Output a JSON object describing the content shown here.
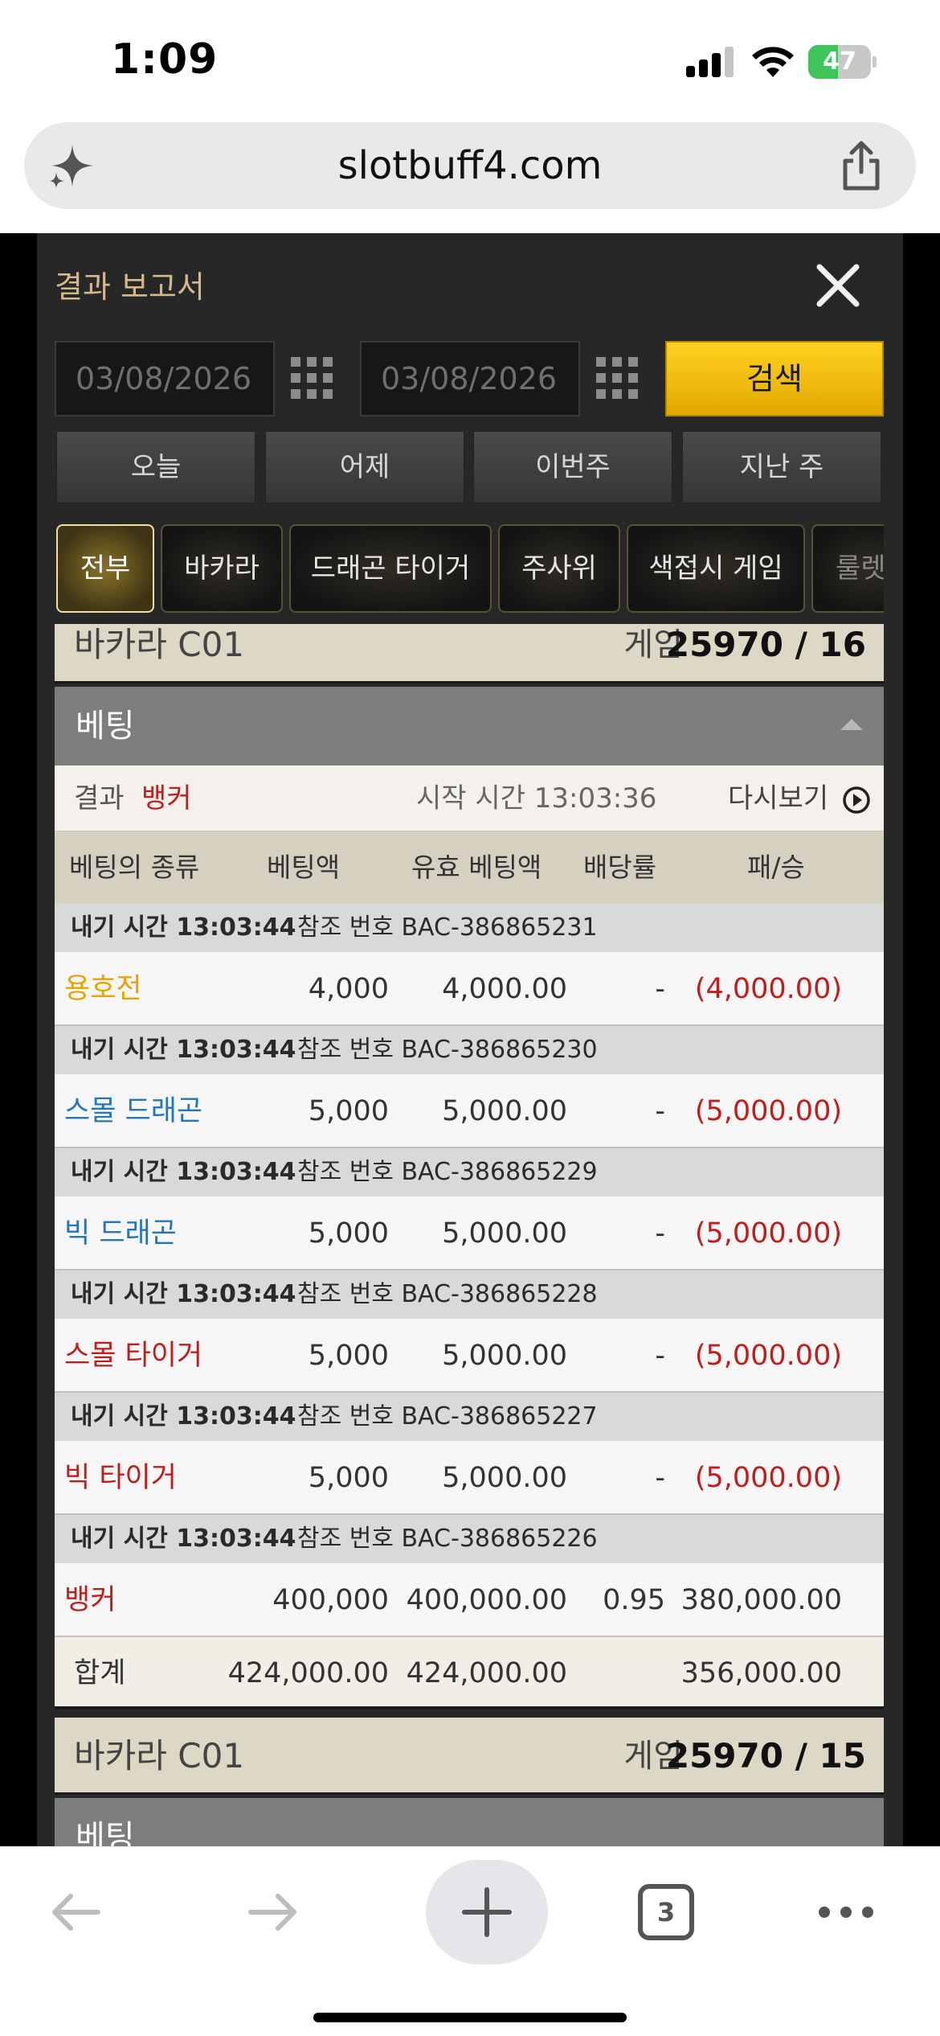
{
  "status_bar": {
    "time": "1:09",
    "battery": "47",
    "battery_level": 0.47
  },
  "browser": {
    "url": "slotbuff4.com",
    "tab_count": "3"
  },
  "report": {
    "title": "결과 보고서",
    "date_from": "03/08/2026",
    "date_to": "03/08/2026",
    "search_label": "검색",
    "periods": [
      "오늘",
      "어제",
      "이번주",
      "지난 주"
    ],
    "filters": [
      "전부",
      "바카라",
      "드래곤 타이거",
      "주사위",
      "색접시 게임",
      "룰렛"
    ]
  },
  "games": [
    {
      "name": "바카라 C01",
      "label": "게임",
      "number": "25970 / 16",
      "betting_title": "베팅",
      "result_label": "결과",
      "result_value": "뱅커",
      "start_time": "시작 시간 13:03:36",
      "replay_label": "다시보기",
      "columns": [
        "베팅의 종류",
        "베팅액",
        "유효 베팅액",
        "배당률",
        "패/승"
      ],
      "bets": [
        {
          "time_label": "내기 시간 13:03:44",
          "ref": "참조 번호 BAC-386865231",
          "type": "용호전",
          "amount": "4,000",
          "valid": "4,000.00",
          "odds": "-",
          "result": "(4,000.00)"
        },
        {
          "time_label": "내기 시간 13:03:44",
          "ref": "참조 번호 BAC-386865230",
          "type": "스몰 드래곤",
          "amount": "5,000",
          "valid": "5,000.00",
          "odds": "-",
          "result": "(5,000.00)"
        },
        {
          "time_label": "내기 시간 13:03:44",
          "ref": "참조 번호 BAC-386865229",
          "type": "빅 드래곤",
          "amount": "5,000",
          "valid": "5,000.00",
          "odds": "-",
          "result": "(5,000.00)"
        },
        {
          "time_label": "내기 시간 13:03:44",
          "ref": "참조 번호 BAC-386865228",
          "type": "스몰 타이거",
          "amount": "5,000",
          "valid": "5,000.00",
          "odds": "-",
          "result": "(5,000.00)"
        },
        {
          "time_label": "내기 시간 13:03:44",
          "ref": "참조 번호 BAC-386865227",
          "type": "빅 타이거",
          "amount": "5,000",
          "valid": "5,000.00",
          "odds": "-",
          "result": "(5,000.00)"
        },
        {
          "time_label": "내기 시간 13:03:44",
          "ref": "참조 번호 BAC-386865226",
          "type": "뱅커",
          "amount": "400,000",
          "valid": "400,000.00",
          "odds": "0.95",
          "result": "380,000.00"
        }
      ],
      "total": {
        "label": "합계",
        "amount": "424,000.00",
        "valid": "424,000.00",
        "result": "356,000.00"
      }
    },
    {
      "name": "바카라 C01",
      "label": "게임",
      "number": "25970 / 15",
      "betting_title": "베팅"
    }
  ],
  "colors": {
    "gold": "#d6b98a",
    "accent_yellow": "#ffc800",
    "loss_red": "#c11d1d",
    "dragon_blue": "#2176bd",
    "tiger_red": "#c11d1d",
    "dragon_tiger_orange": "#e6a400"
  }
}
